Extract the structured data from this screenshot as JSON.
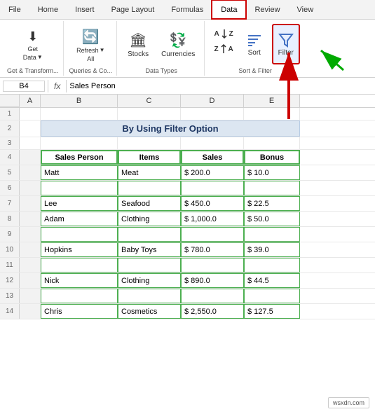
{
  "tabs": [
    "File",
    "Home",
    "Insert",
    "Page Layout",
    "Formulas",
    "Data",
    "Review",
    "View"
  ],
  "active_tab": "Data",
  "groups": {
    "get_transform": {
      "label": "Get & Transform...",
      "buttons": [
        {
          "label": "Get\nData",
          "icon": "⬇"
        }
      ]
    },
    "queries": {
      "label": "Queries & Co...",
      "buttons": [
        {
          "label": "Refresh\nAll",
          "icon": "🔄"
        }
      ]
    },
    "data_types": {
      "label": "Data Types",
      "buttons": [
        {
          "label": "Stocks",
          "icon": "🏛"
        },
        {
          "label": "Currencies",
          "icon": "💱"
        }
      ]
    },
    "sort_filter": {
      "label": "Sort & Filter",
      "sort_btn": "Sort",
      "filter_btn": "Filter",
      "az_btn": "A↑Z",
      "za_btn": "Z↑A"
    }
  },
  "formula_bar": {
    "cell_ref": "B4",
    "fx_label": "fx",
    "formula": "Sales Person"
  },
  "spreadsheet": {
    "col_headers": [
      "",
      "A",
      "B",
      "C",
      "D",
      "E"
    ],
    "title_row": "By Using Filter Option",
    "headers": [
      "Sales Person",
      "Items",
      "Sales",
      "Bonus"
    ],
    "rows": [
      {
        "num": 5,
        "person": "Matt",
        "item": "Meat",
        "sales": "$  200.0",
        "bonus": "$  10.0"
      },
      {
        "num": 6,
        "person": "",
        "item": "",
        "sales": "",
        "bonus": ""
      },
      {
        "num": 7,
        "person": "Lee",
        "item": "Seafood",
        "sales": "$  450.0",
        "bonus": "$  22.5"
      },
      {
        "num": 8,
        "person": "Adam",
        "item": "Clothing",
        "sales": "$  1,000.0",
        "bonus": "$  50.0"
      },
      {
        "num": 9,
        "person": "",
        "item": "",
        "sales": "",
        "bonus": ""
      },
      {
        "num": 10,
        "person": "Hopkins",
        "item": "Baby Toys",
        "sales": "$  780.0",
        "bonus": "$  39.0"
      },
      {
        "num": 11,
        "person": "",
        "item": "",
        "sales": "",
        "bonus": ""
      },
      {
        "num": 12,
        "person": "Nick",
        "item": "Clothing",
        "sales": "$  890.0",
        "bonus": "$  44.5"
      },
      {
        "num": 13,
        "person": "",
        "item": "",
        "sales": "",
        "bonus": ""
      },
      {
        "num": 14,
        "person": "Chris",
        "item": "Cosmetics",
        "sales": "$  2,550.0",
        "bonus": "$  127.5"
      }
    ]
  },
  "watermark": "wsxdn.com"
}
